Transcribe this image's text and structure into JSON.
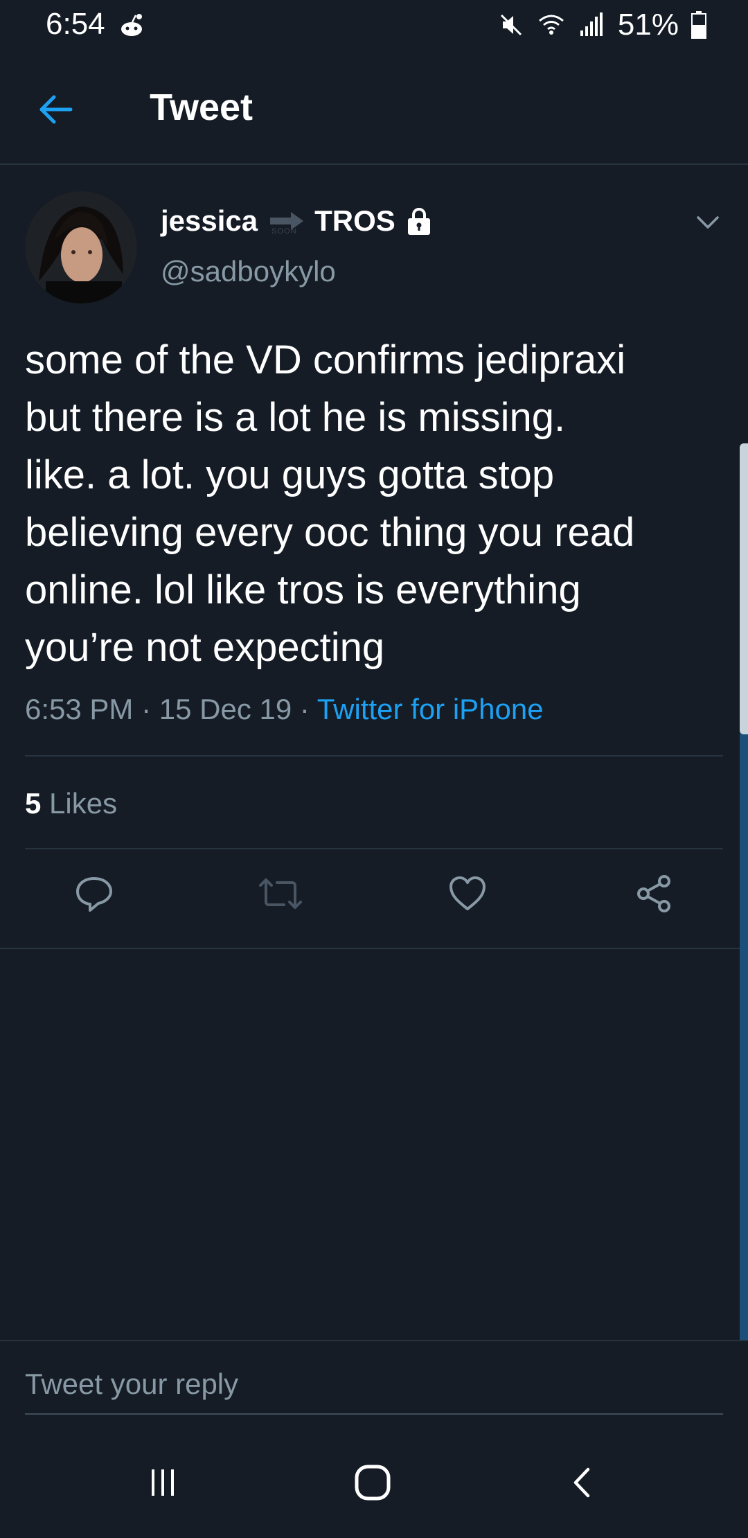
{
  "status_bar": {
    "time": "6:54",
    "battery": "51%",
    "app_icon": "reddit-alien-icon",
    "icons": [
      "mute-icon",
      "wifi-icon",
      "signal-icon",
      "battery-icon"
    ]
  },
  "header": {
    "title": "Tweet",
    "back_icon": "arrow-left-icon"
  },
  "tweet": {
    "display_name_part1": "jessica",
    "display_name_part2": "TROS",
    "emoji_soon_label": "SOON",
    "handle": "@sadboykylo",
    "protected": true,
    "text": "some of the VD confirms jedipraxi\nbut there is a lot he is missing.\nlike. a lot. you guys gotta stop\nbelieving every ooc thing you read\nonline. lol like tros is everything\nyou’re not expecting",
    "time": "6:53 PM",
    "separator1": " · ",
    "date": "15 Dec 19",
    "separator2": " · ",
    "source": "Twitter for iPhone",
    "likes_count": "5",
    "likes_label": "Likes"
  },
  "actions": [
    "reply-icon",
    "retweet-icon",
    "like-icon",
    "share-icon"
  ],
  "reply": {
    "placeholder": "Tweet your reply"
  },
  "navigation": [
    "recents-icon",
    "home-icon",
    "back-icon"
  ],
  "colors": {
    "background": "#151c26",
    "divider": "#283340",
    "accent": "#1da1f2",
    "secondary_text": "#8899a6",
    "primary_text": "#ffffff"
  }
}
